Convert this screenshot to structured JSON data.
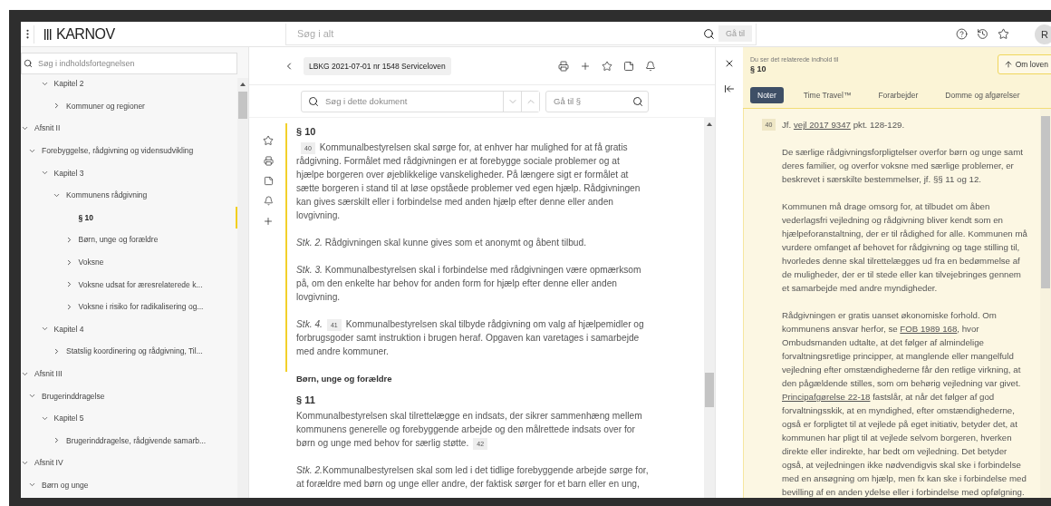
{
  "topbar": {
    "logo": "KARNOV",
    "search": {
      "placeholder": "Søg i alt"
    },
    "goto_button": "Gå til",
    "avatar": "R"
  },
  "sidebar": {
    "search": {
      "placeholder": "Søg i indholdsfortegnelsen"
    },
    "items": [
      {
        "children": [
          {
            "children": [
              {
                "label": "Kapitel 2",
                "expanded": true,
                "selected": false,
                "children": [
                  {
                    "label": "Kommuner og regioner",
                    "expanded": false,
                    "selected": false
                  }
                ]
              }
            ]
          }
        ]
      },
      {
        "label": "Afsnit II",
        "expanded": true,
        "selected": false,
        "children": [
          {
            "label": "Forebyggelse, rådgivning og vidensudvikling",
            "expanded": true,
            "selected": false,
            "children": [
              {
                "label": "Kapitel 3",
                "expanded": true,
                "selected": false,
                "children": [
                  {
                    "label": "Kommunens rådgivning",
                    "expanded": true,
                    "selected": false,
                    "children": [
                      {
                        "label": "§ 10",
                        "selected": true
                      },
                      {
                        "label": "Børn, unge og forældre",
                        "expanded": false,
                        "selected": false
                      },
                      {
                        "label": "Voksne",
                        "expanded": false,
                        "selected": false
                      },
                      {
                        "label": "Voksne udsat for æresrelaterede k...",
                        "expanded": false,
                        "selected": false
                      },
                      {
                        "label": "Voksne i risiko for radikalisering og...",
                        "expanded": false,
                        "selected": false
                      }
                    ]
                  }
                ]
              },
              {
                "label": "Kapitel 4",
                "expanded": true,
                "selected": false,
                "children": [
                  {
                    "label": "Statslig koordinering og rådgivning, Til...",
                    "expanded": false,
                    "selected": false
                  }
                ]
              }
            ]
          }
        ]
      },
      {
        "label": "Afsnit III",
        "expanded": true,
        "selected": false,
        "children": [
          {
            "label": "Brugerinddragelse",
            "expanded": true,
            "selected": false,
            "children": [
              {
                "label": "Kapitel 5",
                "expanded": true,
                "selected": false,
                "children": [
                  {
                    "label": "Brugerinddragelse, rådgivende samarb...",
                    "expanded": false,
                    "selected": false
                  }
                ]
              }
            ]
          }
        ]
      },
      {
        "label": "Afsnit IV",
        "expanded": true,
        "selected": false,
        "children": [
          {
            "label": "Børn og unge",
            "expanded": true,
            "selected": false
          }
        ]
      }
    ]
  },
  "document": {
    "title": "LBKG 2021-07-01 nr 1548 Serviceloven",
    "search": {
      "placeholder": "Søg i dette dokument"
    },
    "goto": {
      "placeholder": "Gå til §"
    },
    "blocks": [
      {
        "kind": "section",
        "heading": "§ 10",
        "highlighted": true,
        "paragraphs": [
          [
            {
              "kind": "note",
              "text": "40"
            },
            {
              "kind": "text",
              "text": "Kommunalbestyrelsen skal sørge for, at enhver har mulighed for at få gratis rådgivning. Formålet med rådgivningen er at forebygge sociale problemer og at hjælpe borgeren over øjeblikkelige vanskeligheder. På længere sigt er formålet at sætte borgeren i stand til at løse opståede problemer ved egen hjælp. Rådgivningen kan gives særskilt eller i forbindelse med anden hjælp efter denne eller anden lovgivning."
            }
          ],
          [
            {
              "kind": "text",
              "text": "*Stk. 2.* Rådgivningen skal kunne gives som et anonymt og åbent tilbud."
            }
          ],
          [
            {
              "kind": "text",
              "text": "*Stk. 3.* Kommunalbestyrelsen skal i forbindelse med rådgivningen være opmærksom på, om den enkelte har behov for anden form for hjælp efter denne eller anden lovgivning."
            }
          ],
          [
            {
              "kind": "text",
              "text": "*Stk. 4.*"
            },
            {
              "kind": "note",
              "text": "41"
            },
            {
              "kind": "text",
              "text": "Kommunalbestyrelsen skal tilbyde rådgivning om valg af hjælpemidler og forbrugsgoder samt instruktion i brugen heraf. Opgaven kan varetages i samarbejde med andre kommuner."
            }
          ]
        ]
      },
      {
        "kind": "title",
        "text": "Børn, unge og forældre"
      },
      {
        "kind": "section",
        "heading": "§ 11",
        "highlighted": false,
        "paragraphs": [
          [
            {
              "kind": "text",
              "text": "Kommunalbestyrelsen skal tilrettelægge en indsats, der sikrer sammenhæng mellem kommunens generelle og forebyggende arbejde og den målrettede indsats over for børn og unge med behov for særlig støtte."
            },
            {
              "kind": "note",
              "text": "42"
            }
          ],
          [
            {
              "kind": "text",
              "text": "*Stk. 2.*"
            },
            {
              "kind": "text",
              "text": "Kommunalbestyrelsen skal som led i det tidlige forebyggende arbejde sørge for, at forældre med børn og unge eller andre, der faktisk sørger for et barn eller en ung,"
            }
          ]
        ]
      }
    ]
  },
  "related": {
    "caption": "Du ser det relaterede indhold til",
    "target": "§ 10",
    "about_button": "Om loven",
    "tabs": [
      {
        "label": "Noter",
        "selected": true
      },
      {
        "label": "Time Travel™",
        "selected": false
      },
      {
        "label": "Forarbejder",
        "selected": false
      },
      {
        "label": "Domme og afgørelser",
        "selected": false
      }
    ],
    "notes": [
      {
        "number": "40",
        "paragraphs": [
          [
            {
              "kind": "text",
              "text": "Jf. "
            },
            {
              "kind": "link",
              "text": "vejl 2017 9347"
            },
            {
              "kind": "text",
              "text": " pkt. 128-129."
            }
          ],
          [
            {
              "kind": "text",
              "text": "De særlige rådgivningsforpligtelser overfor børn og unge samt deres familier, og overfor voksne med særlige problemer, er beskrevet i særskilte bestemmelser, jf. §§ 11 og 12."
            }
          ],
          [
            {
              "kind": "text",
              "text": "Kommunen må drage omsorg for, at tilbudet om åben vederlagsfri vejledning og rådgivning bliver kendt som en hjælpeforanstaltning, der er til rådighed for alle. Kommunen må vurdere omfanget af behovet for rådgivning og tage stilling til, hvorledes denne skal tilrettelægges ud fra en bedømmelse af de muligheder, der er til stede eller kan tilvejebringes gennem et samarbejde med andre myndigheder."
            }
          ],
          [
            {
              "kind": "text",
              "text": "Rådgivningen er gratis uanset økonomiske forhold. Om kommunens ansvar herfor, se "
            },
            {
              "kind": "link",
              "text": "FOB 1989 168"
            },
            {
              "kind": "text",
              "text": ", hvor Ombudsmanden udtalte, at det følger af almindelige forvaltningsretlige principper, at manglende eller mangelfuld vejledning efter omstændighederne får den retlige virkning, at den pågældende stilles, som om behørig vejledning var givet. "
            },
            {
              "kind": "link",
              "text": "Principafgørelse 22-18"
            },
            {
              "kind": "text",
              "text": " fastslår, at når det følger af god forvaltningsskik, at en myndighed, efter omstændighederne, også er forpligtet til at vejlede på eget initiativ, betyder det, at kommunen har pligt til at vejlede selvom borgeren, hverken direkte eller indirekte, har bedt om vejledning. Det betyder også, at vejledningen ikke nødvendigvis skal ske i forbindelse med en ansøgning om hjælp, men fx kan ske i forbindelse med bevilling af en anden ydelse eller i forbindelse med opfølgning."
            }
          ]
        ]
      }
    ]
  }
}
